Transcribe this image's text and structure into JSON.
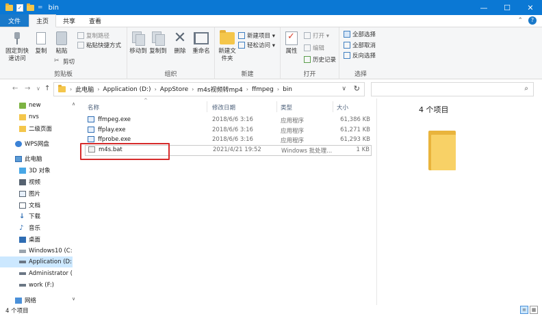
{
  "window": {
    "title": "bin",
    "qa_separator": "=",
    "controls": {
      "minimize": "—",
      "maximize": "☐",
      "close": "✕"
    }
  },
  "tabs": [
    "文件",
    "主页",
    "共享",
    "查看"
  ],
  "ribbon": {
    "clipboard": {
      "group": "剪贴板",
      "pin": "固定到快速访问",
      "copy": "复制",
      "paste": "粘贴",
      "copy_path": "复制路径",
      "paste_shortcut": "粘贴快捷方式",
      "cut": "剪切"
    },
    "organize": {
      "group": "组织",
      "move_to": "移动到",
      "copy_to": "复制到",
      "delete": "删除",
      "rename": "重命名"
    },
    "new": {
      "group": "新建",
      "new_folder": "新建文件夹",
      "new_item": "新建项目 ▾",
      "easy_access": "轻松访问 ▾"
    },
    "open": {
      "group": "打开",
      "properties": "属性",
      "open": "打开 ▾",
      "edit": "编辑",
      "history": "历史记录"
    },
    "select": {
      "group": "选择",
      "select_all": "全部选择",
      "select_none": "全部取消",
      "invert": "反向选择"
    }
  },
  "nav": {
    "back": "←",
    "forward": "→",
    "recent": "∨",
    "up": "↑",
    "breadcrumb": [
      "此电脑",
      "Application (D:)",
      "AppStore",
      "m4s视频转mp4",
      "ffmpeg",
      "bin"
    ],
    "refresh": "↻",
    "search_icon": "⌕"
  },
  "sidebar": [
    {
      "label": "new"
    },
    {
      "label": "nvs"
    },
    {
      "label": "二级页面"
    },
    {
      "label": "WPS网盘"
    },
    {
      "label": "此电脑"
    },
    {
      "label": "3D 对象"
    },
    {
      "label": "视频"
    },
    {
      "label": "图片"
    },
    {
      "label": "文档"
    },
    {
      "label": "下载"
    },
    {
      "label": "音乐"
    },
    {
      "label": "桌面"
    },
    {
      "label": "Windows10 (C:"
    },
    {
      "label": "Application (D:"
    },
    {
      "label": "Administrator ("
    },
    {
      "label": "work (F:)"
    },
    {
      "label": "网络"
    }
  ],
  "columns": {
    "name": "名称",
    "date": "修改日期",
    "type": "类型",
    "size": "大小"
  },
  "files": [
    {
      "name": "ffmpeg.exe",
      "date": "2018/6/6 3:16",
      "type": "应用程序",
      "size": "61,386 KB"
    },
    {
      "name": "ffplay.exe",
      "date": "2018/6/6 3:16",
      "type": "应用程序",
      "size": "61,271 KB"
    },
    {
      "name": "ffprobe.exe",
      "date": "2018/6/6 3:16",
      "type": "应用程序",
      "size": "61,293 KB"
    },
    {
      "name": "m4s.bat",
      "date": "2021/4/21 19:52",
      "type": "Windows 批处理...",
      "size": "1 KB"
    }
  ],
  "preview": {
    "count": "4 个项目"
  },
  "status": {
    "text": "4 个项目"
  }
}
